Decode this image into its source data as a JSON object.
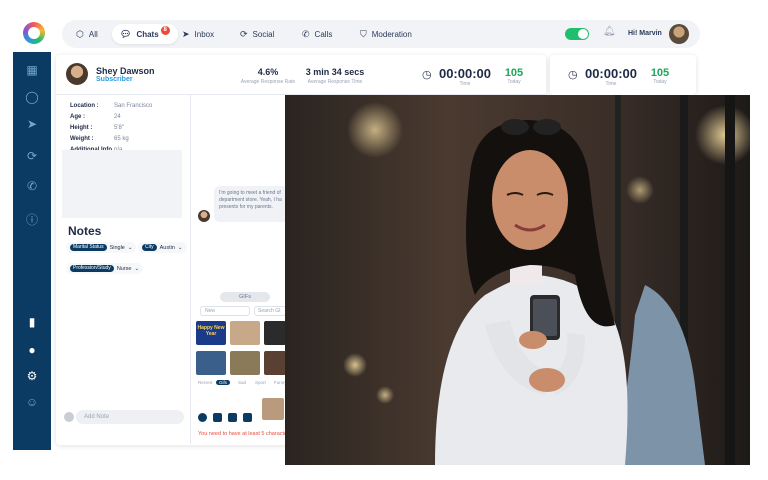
{
  "nav": {
    "tabs": [
      {
        "label": "All",
        "icon": "cube-icon"
      },
      {
        "label": "Chats",
        "icon": "chat-icon",
        "badge": "8"
      },
      {
        "label": "Inbox",
        "icon": "send-icon"
      },
      {
        "label": "Social",
        "icon": "social-icon"
      },
      {
        "label": "Calls",
        "icon": "phone-icon"
      },
      {
        "label": "Moderation",
        "icon": "shield-icon"
      }
    ],
    "greeting": "Hi! Marvin"
  },
  "profile": {
    "name": "Shey Dawson",
    "role": "Subscriber"
  },
  "stats": {
    "response_rate": {
      "value": "4.6%",
      "label": "Average Response Rate"
    },
    "response_time": {
      "value": "3 min 34 secs",
      "label": "Average Response Time"
    }
  },
  "timer1": {
    "time": "00:00:00",
    "time_label": "Time",
    "today": "105",
    "today_label": "Today"
  },
  "timer2": {
    "time": "00:00:00",
    "time_label": "Time",
    "today": "105",
    "today_label": "Today"
  },
  "info": [
    {
      "k": "Location :",
      "v": "San Francisco"
    },
    {
      "k": "Age :",
      "v": "24"
    },
    {
      "k": "Height :",
      "v": "5'8\""
    },
    {
      "k": "Weight :",
      "v": "65 kg"
    },
    {
      "k": "Additional Info :",
      "v": "n/a"
    }
  ],
  "notes": {
    "title": "Notes",
    "chips": [
      {
        "tag": "Marital Status",
        "value": "Single"
      },
      {
        "tag": "City",
        "value": "Austin"
      },
      {
        "tag": "Profession/Study",
        "value": "Nurse"
      }
    ],
    "add_placeholder": "Add Note"
  },
  "chat": {
    "message": "I'm going to meet a friend of department store. Yeah, I ha presents for my parents.",
    "gifs_label": "GIFs",
    "gif_select": "New",
    "gif_search": "Search GI",
    "thumb_text": "Happy New Year",
    "gif_categories": [
      "Recent",
      "Gifs",
      "Sad",
      "Sport",
      "Funny"
    ],
    "warning": "You need to have at least 5 characters"
  },
  "colors": {
    "sidebar": "#0b3b63",
    "accent_green": "#1fa45c",
    "accent_blue": "#2d98da"
  }
}
